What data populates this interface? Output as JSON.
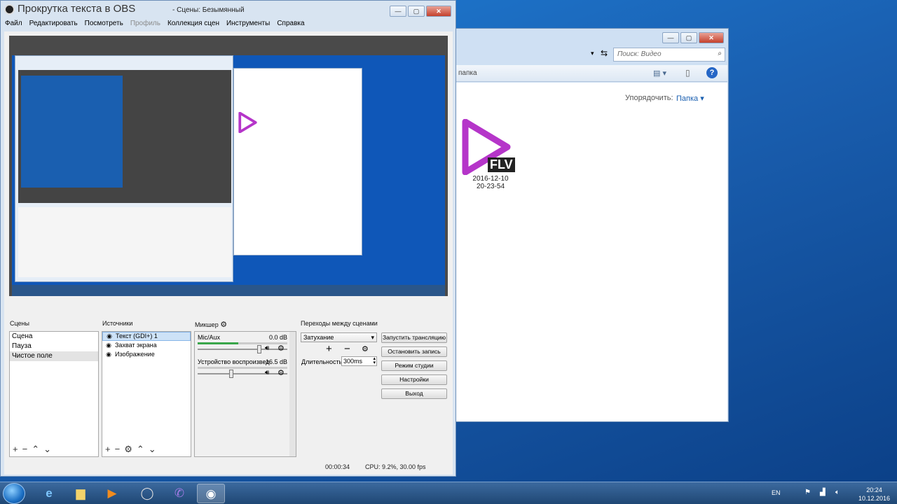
{
  "obs": {
    "title_partial": "Прокрутка текста в OBS",
    "title_suffix": "- Сцены: Безымянный",
    "menu": [
      {
        "label": "Файл",
        "enabled": true
      },
      {
        "label": "Редактировать",
        "enabled": true
      },
      {
        "label": "Посмотреть",
        "enabled": true
      },
      {
        "label": "Профиль",
        "enabled": false
      },
      {
        "label": "Коллекция сцен",
        "enabled": true
      },
      {
        "label": "Инструменты",
        "enabled": true
      },
      {
        "label": "Справка",
        "enabled": true
      }
    ],
    "scenes": {
      "label": "Сцены",
      "items": [
        "Сцена",
        "Пауза",
        "Чистое поле"
      ],
      "selected_index": 2
    },
    "sources": {
      "label": "Источники",
      "items": [
        "Текст (GDI+) 1",
        "Захват экрана",
        "Изображение"
      ],
      "selected_index": 0
    },
    "mixer": {
      "label": "Микшер",
      "channels": [
        {
          "name": "Mic/Aux",
          "level": "0.0 dB",
          "fader": 0.92
        },
        {
          "name": "Устройство воспроизвед",
          "level": "-16.5 dB",
          "fader": 0.38
        }
      ]
    },
    "transitions": {
      "label": "Переходы между сценами",
      "selected": "Затухание",
      "duration_label": "Длительность",
      "duration_value": "300ms"
    },
    "controls": {
      "start_stream": "Запустить трансляцию",
      "stop_record": "Остановить запись",
      "studio_mode": "Режим студии",
      "settings": "Настройки",
      "exit": "Выход"
    },
    "status": {
      "time": "00:00:34",
      "cpu": "CPU: 9.2%, 30.00 fps"
    }
  },
  "explorer": {
    "search_placeholder": "Поиск: Видео",
    "folder_label": "папка",
    "sort_label": "Упорядочить:",
    "sort_value": "Папка",
    "file": {
      "badge": "FLV",
      "date": "2016-12-10",
      "time": "20-23-54"
    }
  },
  "taskbar": {
    "lang": "EN",
    "clock_time": "20:24",
    "clock_date": "10.12.2016"
  },
  "colors": {
    "flv_purple": "#b535c9",
    "desktop_blue": "#1a5fb0",
    "preview_bg": "#4a4a4a"
  }
}
